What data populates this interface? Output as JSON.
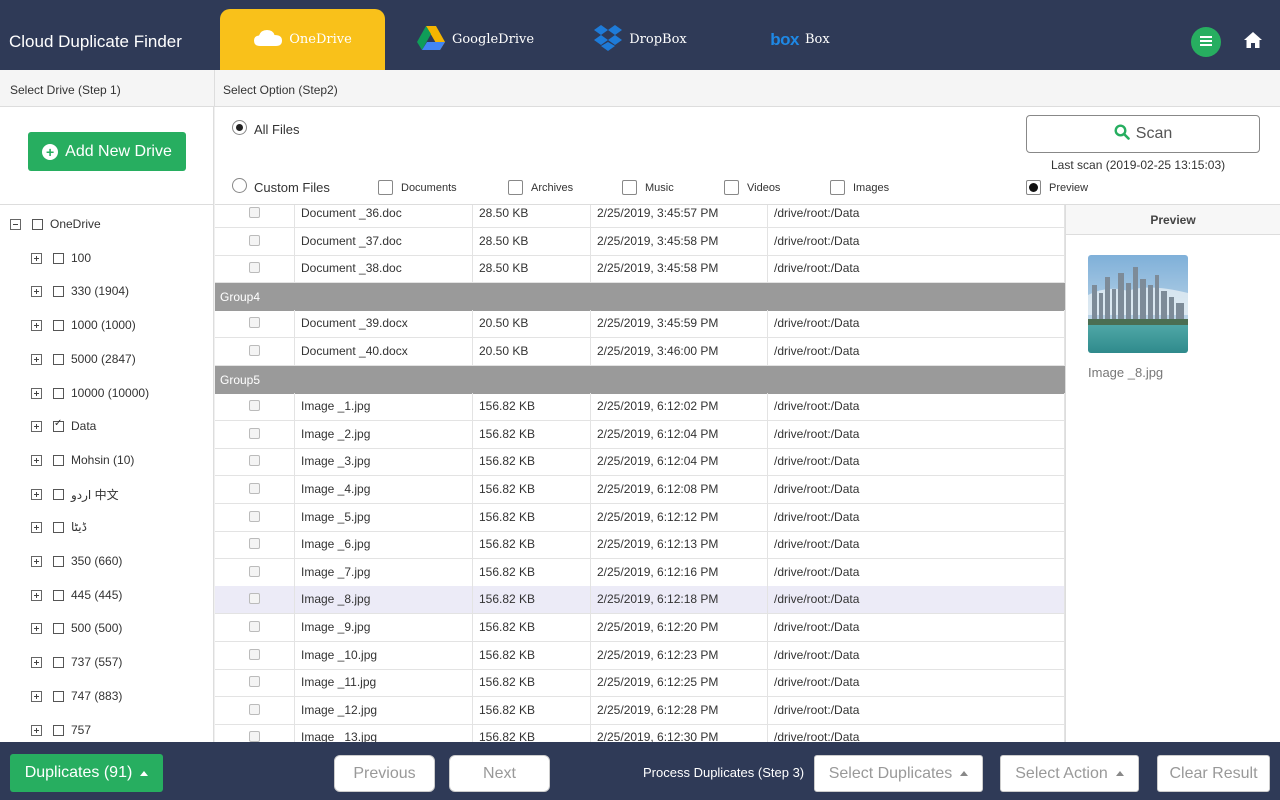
{
  "app": {
    "title": "Cloud Duplicate Finder"
  },
  "tabs": [
    {
      "label": "OneDrive",
      "icon": "cloud-icon"
    },
    {
      "label": "GoogleDrive",
      "icon": "google-drive-icon"
    },
    {
      "label": "DropBox",
      "icon": "dropbox-icon"
    },
    {
      "label": "Box",
      "logo": "box"
    }
  ],
  "steps": {
    "step1": "Select Drive (Step 1)",
    "step2": "Select Option (Step2)",
    "step3": "Process Duplicates (Step 3)"
  },
  "left": {
    "add_drive": "Add New Drive",
    "tree": {
      "root": "OneDrive",
      "items": [
        "100",
        "330 (1904)",
        "1000 (1000)",
        "5000 (2847)",
        "10000 (10000)",
        "Data",
        "Mohsin (10)",
        "اردو 中文",
        "ڈیٹا",
        "350 (660)",
        "445 (445)",
        "500 (500)",
        "737 (557)",
        "747 (883)",
        "757"
      ],
      "checked": "Data"
    }
  },
  "options": {
    "all_files": "All Files",
    "custom_files": "Custom Files",
    "filters": [
      "Documents",
      "Archives",
      "Music",
      "Videos",
      "Images"
    ],
    "preview_label": "Preview",
    "scan_label": "Scan",
    "last_scan": "Last scan (2019-02-25 13:15:03)"
  },
  "table": {
    "rows": [
      {
        "type": "file",
        "name": "Document _36.doc",
        "size": "28.50 KB",
        "date": "2/25/2019, 3:45:57 PM",
        "path": "/drive/root:/Data"
      },
      {
        "type": "file",
        "name": "Document _37.doc",
        "size": "28.50 KB",
        "date": "2/25/2019, 3:45:58 PM",
        "path": "/drive/root:/Data"
      },
      {
        "type": "file",
        "name": "Document _38.doc",
        "size": "28.50 KB",
        "date": "2/25/2019, 3:45:58 PM",
        "path": "/drive/root:/Data"
      },
      {
        "type": "group",
        "label": "Group4"
      },
      {
        "type": "file",
        "name": "Document _39.docx",
        "size": "20.50 KB",
        "date": "2/25/2019, 3:45:59 PM",
        "path": "/drive/root:/Data"
      },
      {
        "type": "file",
        "name": "Document _40.docx",
        "size": "20.50 KB",
        "date": "2/25/2019, 3:46:00 PM",
        "path": "/drive/root:/Data"
      },
      {
        "type": "group",
        "label": "Group5"
      },
      {
        "type": "file",
        "name": "Image _1.jpg",
        "size": "156.82 KB",
        "date": "2/25/2019, 6:12:02 PM",
        "path": "/drive/root:/Data"
      },
      {
        "type": "file",
        "name": "Image _2.jpg",
        "size": "156.82 KB",
        "date": "2/25/2019, 6:12:04 PM",
        "path": "/drive/root:/Data"
      },
      {
        "type": "file",
        "name": "Image _3.jpg",
        "size": "156.82 KB",
        "date": "2/25/2019, 6:12:04 PM",
        "path": "/drive/root:/Data"
      },
      {
        "type": "file",
        "name": "Image _4.jpg",
        "size": "156.82 KB",
        "date": "2/25/2019, 6:12:08 PM",
        "path": "/drive/root:/Data"
      },
      {
        "type": "file",
        "name": "Image _5.jpg",
        "size": "156.82 KB",
        "date": "2/25/2019, 6:12:12 PM",
        "path": "/drive/root:/Data"
      },
      {
        "type": "file",
        "name": "Image _6.jpg",
        "size": "156.82 KB",
        "date": "2/25/2019, 6:12:13 PM",
        "path": "/drive/root:/Data"
      },
      {
        "type": "file",
        "name": "Image _7.jpg",
        "size": "156.82 KB",
        "date": "2/25/2019, 6:12:16 PM",
        "path": "/drive/root:/Data"
      },
      {
        "type": "file",
        "name": "Image _8.jpg",
        "size": "156.82 KB",
        "date": "2/25/2019, 6:12:18 PM",
        "path": "/drive/root:/Data",
        "selected": true
      },
      {
        "type": "file",
        "name": "Image _9.jpg",
        "size": "156.82 KB",
        "date": "2/25/2019, 6:12:20 PM",
        "path": "/drive/root:/Data"
      },
      {
        "type": "file",
        "name": "Image _10.jpg",
        "size": "156.82 KB",
        "date": "2/25/2019, 6:12:23 PM",
        "path": "/drive/root:/Data"
      },
      {
        "type": "file",
        "name": "Image _11.jpg",
        "size": "156.82 KB",
        "date": "2/25/2019, 6:12:25 PM",
        "path": "/drive/root:/Data"
      },
      {
        "type": "file",
        "name": "Image _12.jpg",
        "size": "156.82 KB",
        "date": "2/25/2019, 6:12:28 PM",
        "path": "/drive/root:/Data"
      },
      {
        "type": "file",
        "name": "Image _13.jpg",
        "size": "156.82 KB",
        "date": "2/25/2019, 6:12:30 PM",
        "path": "/drive/root:/Data"
      }
    ]
  },
  "preview": {
    "title": "Preview",
    "file_name": "Image _8.jpg"
  },
  "footer": {
    "duplicates": "Duplicates (91)",
    "previous": "Previous",
    "next": "Next",
    "select_duplicates": "Select Duplicates",
    "select_action": "Select Action",
    "clear_result": "Clear Result"
  },
  "colors": {
    "header": "#2f3a57",
    "accent_green": "#27ae60",
    "active_tab": "#f9c11a",
    "group_row": "#9a9a9a"
  }
}
